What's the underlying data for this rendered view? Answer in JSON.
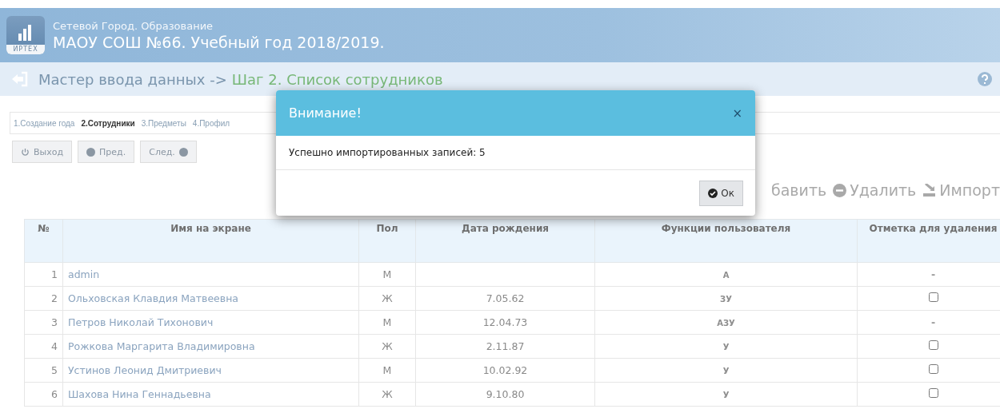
{
  "header": {
    "logo_text": "ИРТЕХ",
    "subtitle": "Сетевой Город. Образование",
    "title": "МАОУ СОШ №66. Учебный год 2018/2019."
  },
  "breadcrumb": {
    "prefix": "Мастер ввода данных ->",
    "current": "Шаг 2. Список сотрудников"
  },
  "steps": [
    {
      "label": "1.Создание года",
      "selected": false
    },
    {
      "label": "2.Сотрудники",
      "selected": true
    },
    {
      "label": "3.Предметы",
      "selected": false
    },
    {
      "label": "4.Профил",
      "selected": false
    }
  ],
  "nav_buttons": [
    {
      "kind": "exit",
      "label": "Выход"
    },
    {
      "kind": "prev",
      "label": "Пред."
    },
    {
      "kind": "next",
      "label": "След."
    }
  ],
  "actions": [
    {
      "kind": "add",
      "label": "бавить"
    },
    {
      "kind": "delete",
      "label": "Удалить"
    },
    {
      "kind": "import",
      "label": "Импорт"
    }
  ],
  "table": {
    "columns": [
      "№",
      "Имя на экране",
      "Пол",
      "Дата рождения",
      "Функции пользователя",
      "Отметка для удаления"
    ],
    "rows": [
      {
        "num": "1",
        "name": "admin",
        "sex": "М",
        "birth": "",
        "roles": "А",
        "mark": {
          "kind": "dash",
          "text": "-"
        }
      },
      {
        "num": "2",
        "name": "Ольховская Клавдия Матвеевна",
        "sex": "Ж",
        "birth": "7.05.62",
        "roles": "ЗУ",
        "mark": {
          "kind": "checkbox",
          "checked": false
        }
      },
      {
        "num": "3",
        "name": "Петров Николай Тихонович",
        "sex": "М",
        "birth": "12.04.73",
        "roles": "АЗУ",
        "mark": {
          "kind": "dash",
          "text": "-"
        }
      },
      {
        "num": "4",
        "name": "Рожкова Маргарита Владимировна",
        "sex": "Ж",
        "birth": "2.11.87",
        "roles": "У",
        "mark": {
          "kind": "checkbox",
          "checked": false
        }
      },
      {
        "num": "5",
        "name": "Устинов Леонид Дмитриевич",
        "sex": "М",
        "birth": "10.02.92",
        "roles": "У",
        "mark": {
          "kind": "checkbox",
          "checked": false
        }
      },
      {
        "num": "6",
        "name": "Шахова Нина Геннадьевна",
        "sex": "Ж",
        "birth": "9.10.80",
        "roles": "У",
        "mark": {
          "kind": "checkbox",
          "checked": false
        }
      }
    ]
  },
  "dialog": {
    "title": "Внимание!",
    "close": "×",
    "message": "Успешно импортированных записей: 5",
    "ok": "Ок"
  }
}
